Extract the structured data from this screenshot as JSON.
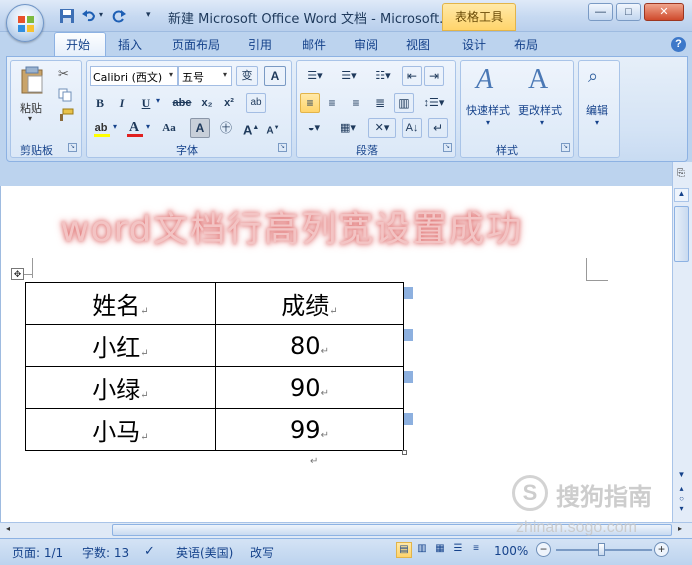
{
  "window": {
    "title": "新建 Microsoft Office Word 文档 - Microsoft...",
    "context_tab": "表格工具",
    "controls": [
      "—",
      "□",
      "✕"
    ]
  },
  "tabs": [
    "开始",
    "插入",
    "页面布局",
    "引用",
    "邮件",
    "审阅",
    "视图",
    "设计",
    "布局"
  ],
  "ribbon": {
    "clipboard": {
      "label": "剪贴板",
      "paste": "粘贴"
    },
    "font": {
      "label": "字体",
      "font_name": "Calibri (西文)",
      "font_size": "五号",
      "bold": "B",
      "italic": "I",
      "underline": "U",
      "strike": "abe",
      "subscript": "x₂",
      "superscript": "x²",
      "grow": "A",
      "shrink": "A",
      "case": "Aa",
      "phonetic": "变",
      "border_char": "A"
    },
    "paragraph": {
      "label": "段落"
    },
    "styles": {
      "label": "样式",
      "quick_styles": "快速样式",
      "change_styles": "更改样式"
    },
    "editing": {
      "label": "编辑"
    }
  },
  "overlay_text": "word文档行高列宽设置成功",
  "table": {
    "rows": [
      [
        "姓名",
        "成绩"
      ],
      [
        "小红",
        "80"
      ],
      [
        "小绿",
        "90"
      ],
      [
        "小马",
        "99"
      ]
    ]
  },
  "statusbar": {
    "page": "页面: 1/1",
    "words": "字数: 13",
    "language": "英语(美国)",
    "mode": "改写",
    "zoom": "100%"
  },
  "watermark": {
    "brand": "搜狗指南",
    "url": "zhinan.sogo.com"
  }
}
